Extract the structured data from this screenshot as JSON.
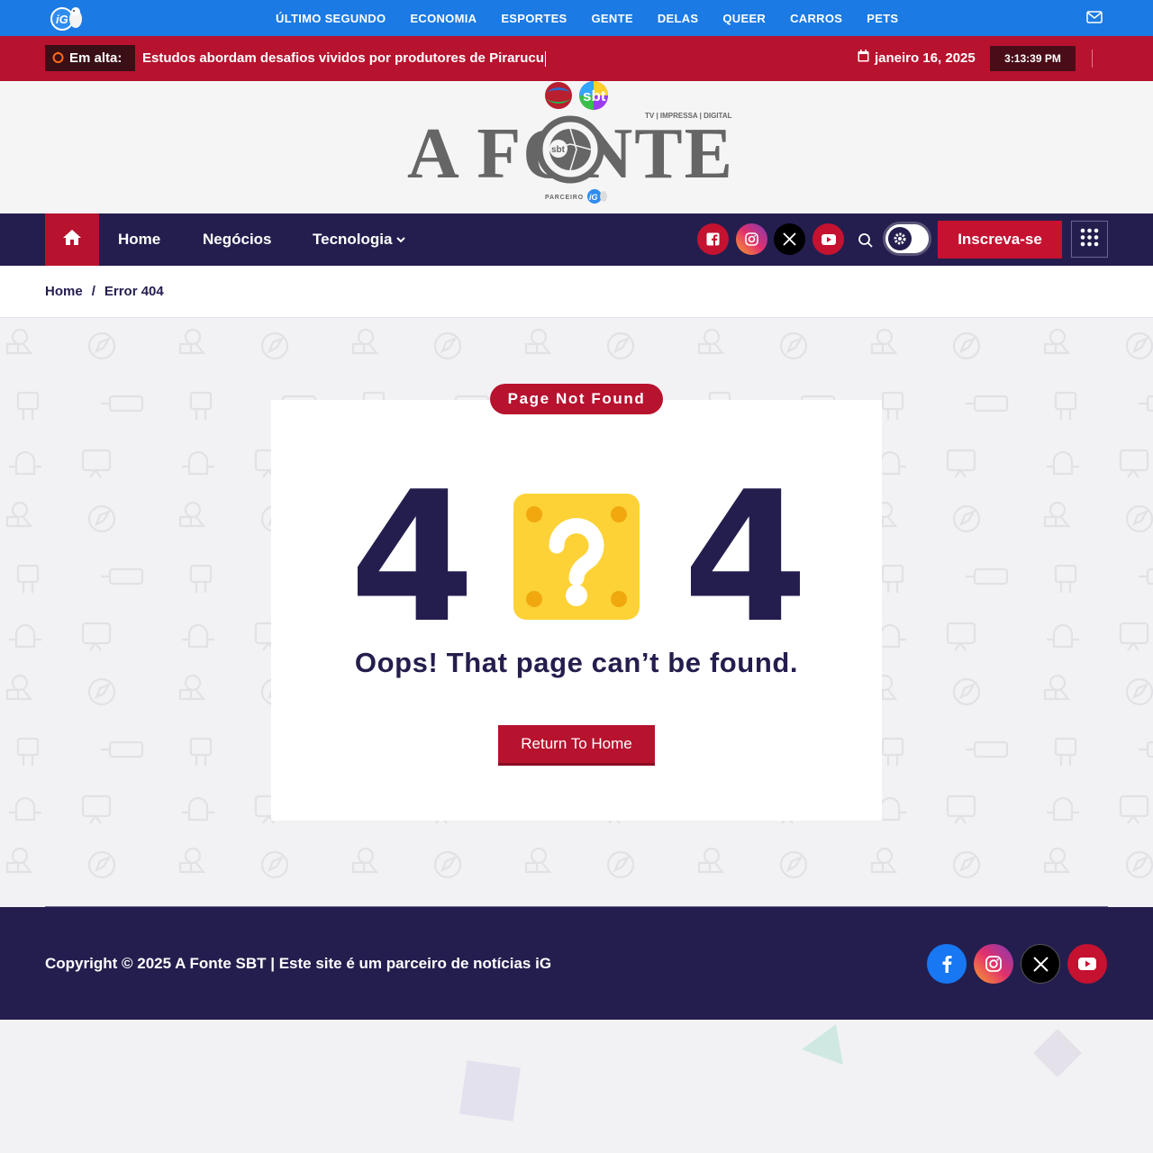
{
  "topbar": {
    "nav": [
      "ÚLTIMO SEGUNDO",
      "ECONOMIA",
      "ESPORTES",
      "GENTE",
      "DELAS",
      "QUEER",
      "CARROS",
      "PETS"
    ]
  },
  "trending": {
    "label": "Em alta:",
    "headline": "Estudos abordam desafios vividos por produtores de Pirarucu",
    "date": "janeiro 16, 2025",
    "time": "3:13:39 PM"
  },
  "logo": {
    "title": "A FONTE",
    "tagline": "TV | IMPRESSA | DIGITAL",
    "partner": "PARCEIRO",
    "network": "sbt"
  },
  "mainnav": {
    "items": [
      "Home",
      "Negócios",
      "Tecnologia"
    ],
    "subscribe": "Inscreva-se"
  },
  "breadcrumb": {
    "home": "Home",
    "separator": "/",
    "current": "Error 404"
  },
  "error": {
    "badge": "Page Not Found",
    "digit_left": "4",
    "digit_right": "4",
    "message": "Oops! That page can’t be found.",
    "button": "Return To Home"
  },
  "footer": {
    "copyright": "Copyright © 2025 A Fonte SBT | Este site é um parceiro de notícias iG"
  },
  "colors": {
    "brand_red": "#b7122e",
    "navy": "#241e4e",
    "top_blue": "#1b7ae3",
    "question_yellow": "#fdd236"
  }
}
